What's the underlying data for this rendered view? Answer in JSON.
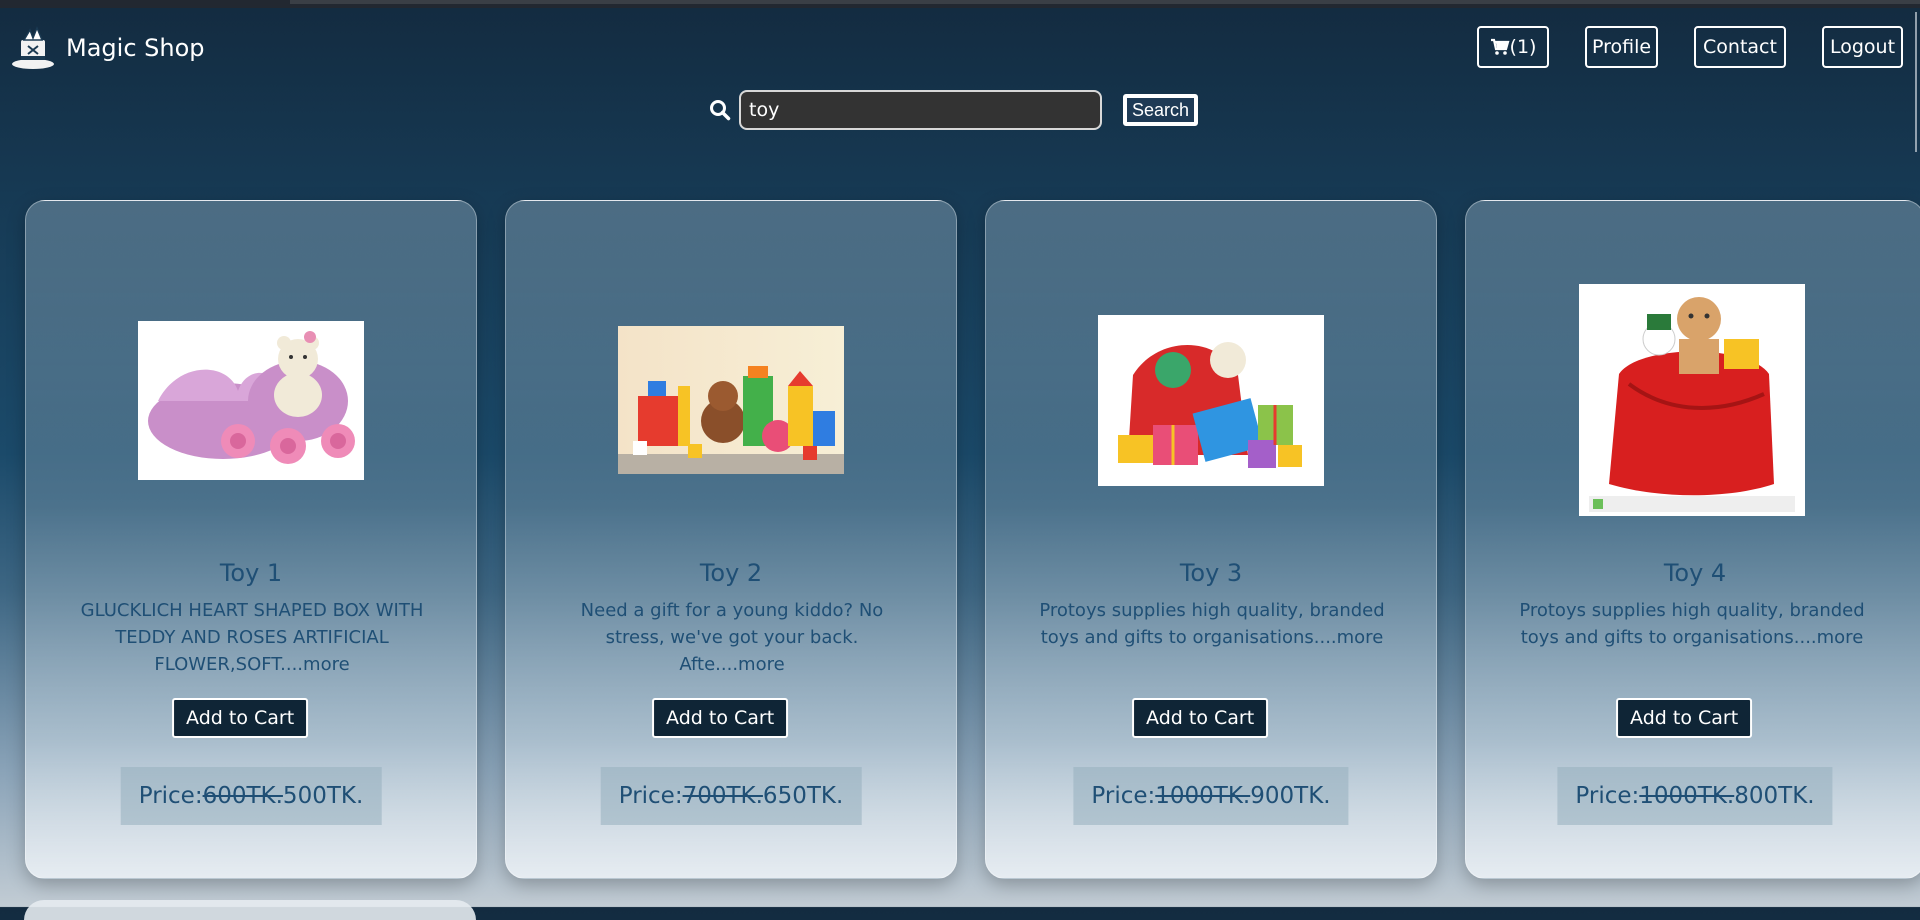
{
  "header": {
    "brand": "Magic Shop",
    "cart_label": "(1)",
    "profile_label": "Profile",
    "contact_label": "Contact",
    "logout_label": "Logout"
  },
  "search": {
    "value": "toy",
    "button_label": "Search"
  },
  "products": [
    {
      "name": "Toy 1",
      "description": "GLUCKLICH HEART SHAPED BOX WITH TEDDY AND ROSES ARTIFICIAL FLOWER,SOFT....more",
      "add_label": "Add to Cart",
      "price_label": "Price:",
      "old_price": "600TK.",
      "new_price": "500TK."
    },
    {
      "name": "Toy 2",
      "description": "Need a gift for a young kiddo? No stress, we've got your back. Afte....more",
      "add_label": "Add to Cart",
      "price_label": "Price:",
      "old_price": "700TK.",
      "new_price": "650TK."
    },
    {
      "name": "Toy 3",
      "description": "Protoys supplies high quality, branded toys and gifts to organisations....more",
      "add_label": "Add to Cart",
      "price_label": "Price:",
      "old_price": "1000TK.",
      "new_price": "900TK."
    },
    {
      "name": "Toy 4",
      "description": "Protoys supplies high quality, branded toys and gifts to organisations....more",
      "add_label": "Add to Cart",
      "price_label": "Price:",
      "old_price": "1000TK.",
      "new_price": "800TK."
    }
  ]
}
